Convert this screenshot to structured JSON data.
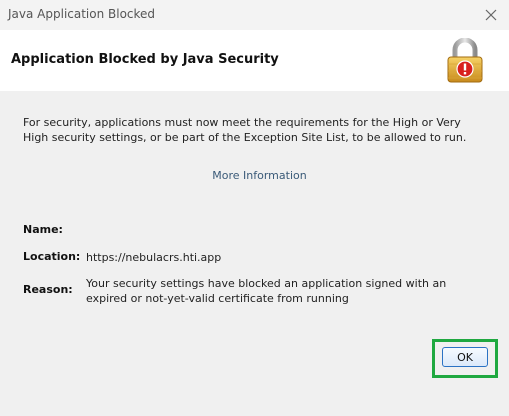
{
  "window": {
    "title": "Java Application Blocked"
  },
  "header": {
    "title": "Application Blocked by Java Security"
  },
  "message": "For security, applications must now meet the requirements for the High or Very High security settings, or be part of the Exception Site List, to be allowed to run.",
  "more_info": "More Information",
  "details": {
    "name_label": "Name:",
    "name_value": "",
    "location_label": "Location:",
    "location_value": "https://nebulacrs.hti.app",
    "reason_label": "Reason:",
    "reason_value": "Your security settings have blocked an application signed with an expired or not-yet-valid certificate from running"
  },
  "buttons": {
    "ok": "OK"
  },
  "icons": {
    "close": "close-icon",
    "lock": "lock-warning-icon"
  },
  "colors": {
    "highlight": "#1fa840",
    "link": "#3a5a78",
    "button_border": "#2a72c4"
  }
}
